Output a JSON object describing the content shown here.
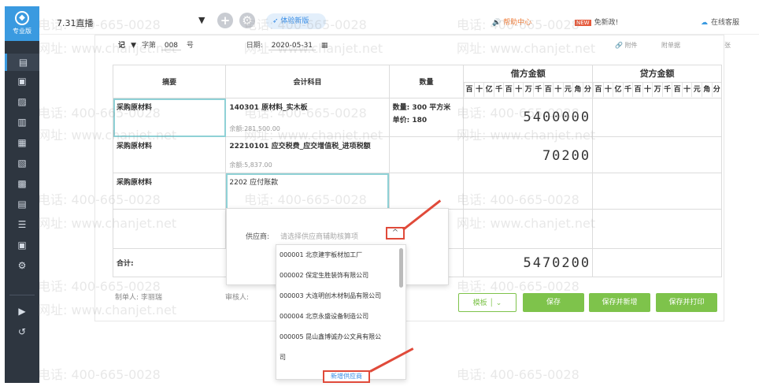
{
  "sidebar": {
    "logo_text": "专业版",
    "items": [
      "voucher",
      "ledger",
      "report",
      "bill",
      "invoice",
      "tax",
      "account",
      "asset",
      "cash",
      "settings",
      "other"
    ],
    "extra": [
      "view",
      "logout"
    ]
  },
  "topbar": {
    "tab_title": "7.31直播",
    "new_version": "体验新版",
    "help": "帮助中心",
    "new_badge": "NEW",
    "new_policy": "免新政!",
    "online_service": "在线客服"
  },
  "voucher_meta": {
    "type": "记",
    "zi_label": "字第",
    "number": "008",
    "hao_label": "号",
    "date_label": "日期:",
    "date": "2020-05-31",
    "attachment": "附件",
    "attach_count": "附单据",
    "zhang": "张"
  },
  "table": {
    "headers": {
      "summary": "摘要",
      "account": "会计科目",
      "qty": "数量",
      "debit": "借方金额",
      "credit": "贷方金额"
    },
    "digit_units": [
      "百",
      "十",
      "亿",
      "千",
      "百",
      "十",
      "万",
      "千",
      "百",
      "十",
      "元",
      "角",
      "分"
    ],
    "rows": [
      {
        "summary": "采购原材料",
        "account": "140301 原材料_实木板",
        "balance": "余额:281,500.00",
        "qty_line1": "数量: 300 平方米",
        "qty_line2": "单价: 180",
        "debit": "5400000",
        "credit": ""
      },
      {
        "summary": "采购原材料",
        "account": "22210101 应交税费_应交增值税_进项税额",
        "balance": "余额:5,837.00",
        "qty_line1": "",
        "qty_line2": "",
        "debit": "70200",
        "credit": ""
      },
      {
        "summary": "采购原材料",
        "account": "2202   应付账款",
        "balance": "",
        "qty_line1": "",
        "qty_line2": "",
        "debit": "",
        "credit": ""
      }
    ],
    "total_label": "合计:",
    "total_debit": "5470200"
  },
  "supplier_dropdown": {
    "label": "供应商:",
    "placeholder": "请选择供应商辅助核算项",
    "toggle": "^",
    "options": [
      "000001 北京建宇板材加工厂",
      "000002 保定生胜装饰有限公司",
      "000003 大连明创木材制品有限公司",
      "000004 北京永盛设备制造公司",
      "000005 昆山鑫博诚办公文具有限公",
      "司"
    ],
    "add_label": "新增供应商"
  },
  "footer": {
    "maker_label": "制单人: 李丽瑞",
    "reviewer_label": "审核人:",
    "template_btn": "模板",
    "save_btn": "保存",
    "save_new_btn": "保存并新增",
    "save_print_btn": "保存并打印"
  },
  "watermarks": [
    "电话: 400-665-0028",
    "网址: www.chanjet.net"
  ]
}
